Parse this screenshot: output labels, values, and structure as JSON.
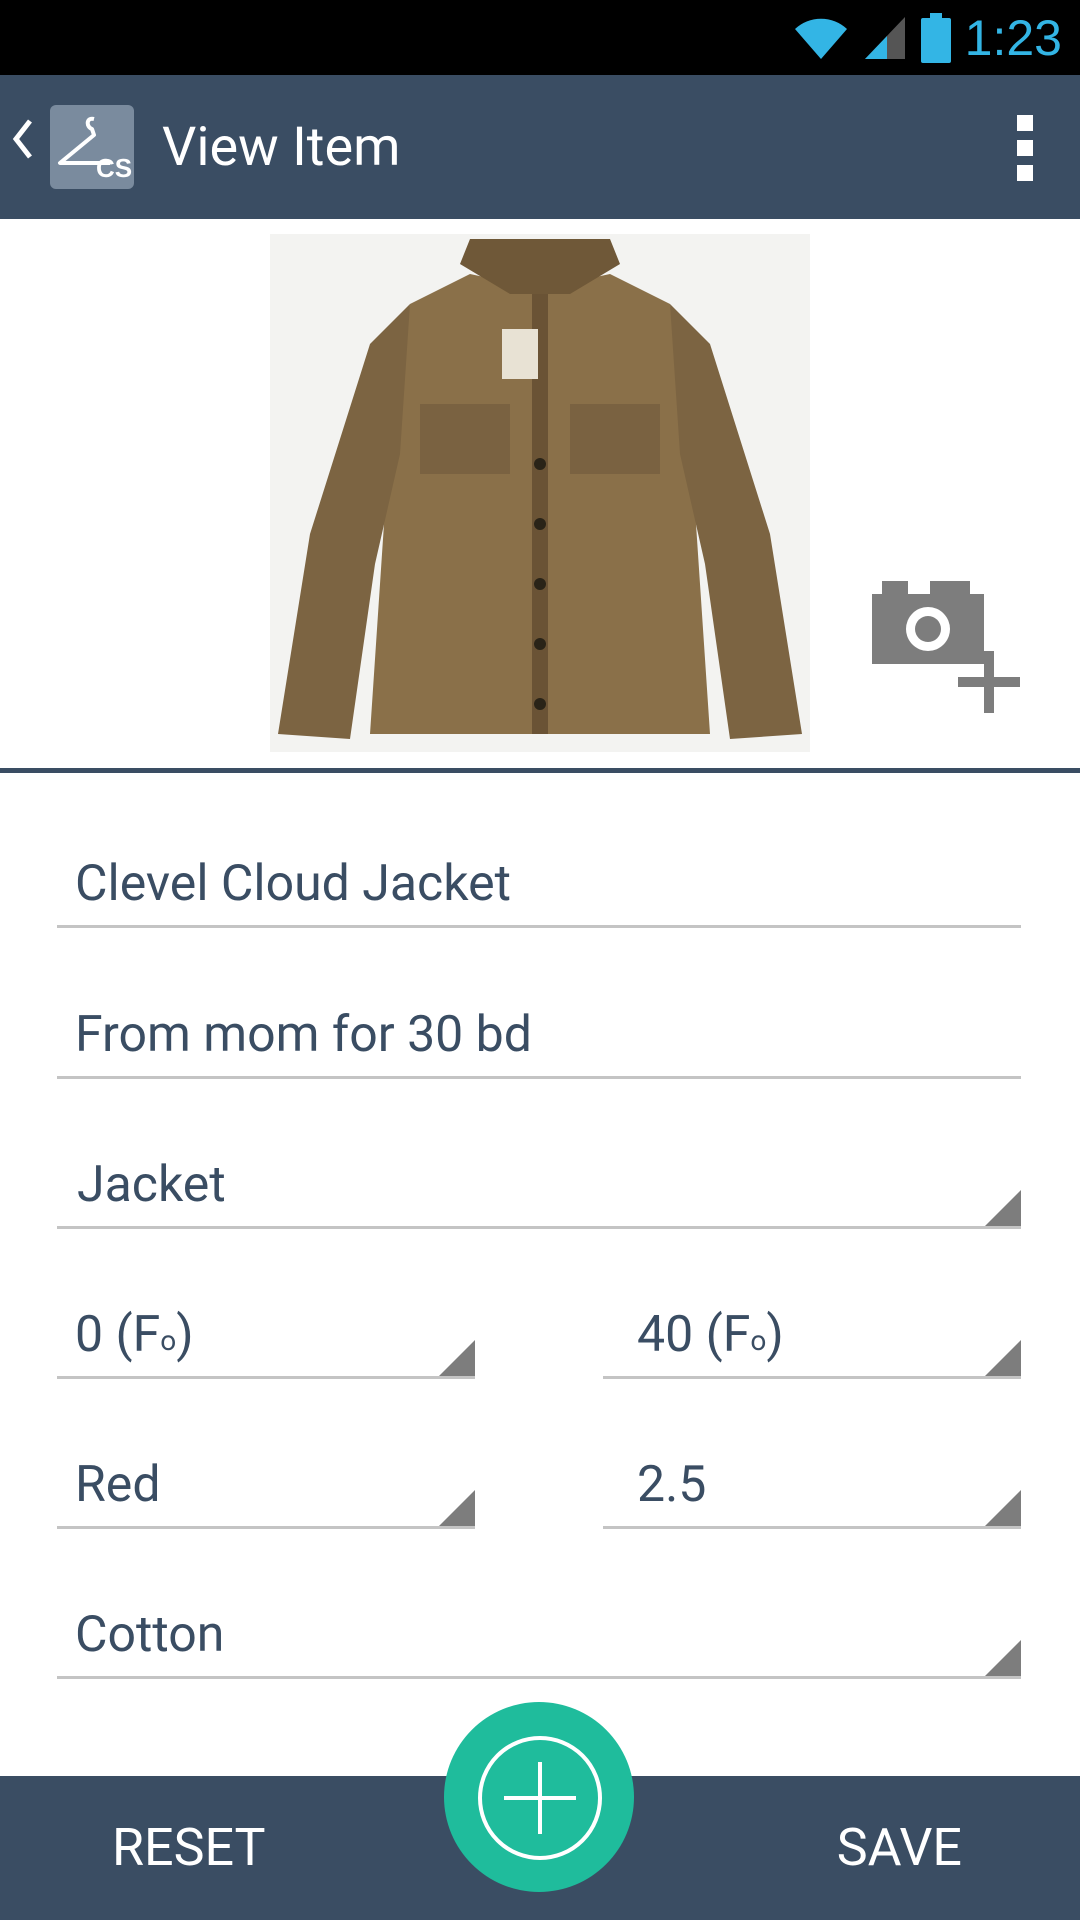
{
  "status_bar": {
    "time": "1:23",
    "wifi_icon": "wifi-icon",
    "signal_icon": "cell-signal-icon",
    "battery_icon": "battery-icon",
    "accent": "#33b5e5"
  },
  "action_bar": {
    "title": "View Item",
    "app_icon": "hanger-icon",
    "app_icon_text": "CS",
    "overflow_icon": "overflow-menu-icon",
    "color": "#3a4d63"
  },
  "photo": {
    "image": "jacket-photo",
    "add_photo_icon": "add-photo-icon"
  },
  "form": {
    "name": "Clevel Cloud Jacket",
    "note": "From mom for 30 bd",
    "category": "Jacket",
    "temp_min": "0 (F",
    "temp_min_unit": "o",
    "temp_min_end": ")",
    "temp_max": "40 (F",
    "temp_max_unit": "o",
    "temp_max_end": ")",
    "color": "Red",
    "size": "2.5",
    "material": "Cotton"
  },
  "bottom_bar": {
    "reset_label": "RESET",
    "save_label": "SAVE",
    "fab_icon": "add-circle-icon",
    "fab_color": "#1fbc9c"
  }
}
